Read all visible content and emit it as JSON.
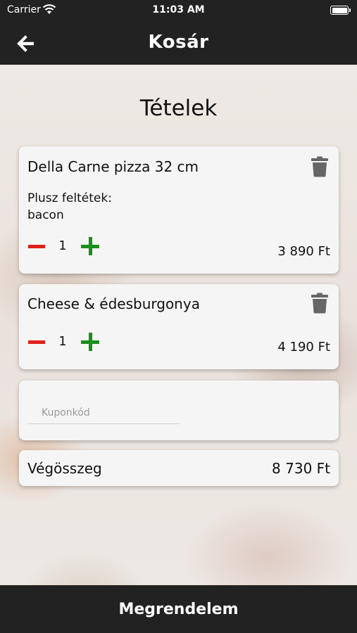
{
  "status_bar": {
    "carrier": "Carrier",
    "time": "11:03 AM"
  },
  "nav": {
    "title": "Kosár",
    "back_icon": "arrow-left-icon"
  },
  "section_title": "Tételek",
  "cart": {
    "items": [
      {
        "name": "Della Carne pizza 32 cm",
        "extras_label": "Plusz feltétek:",
        "extras": "bacon",
        "quantity": "1",
        "price": "3 890 Ft"
      },
      {
        "name": "Cheese & édesburgonya",
        "quantity": "1",
        "price": "4 190 Ft"
      }
    ],
    "coupon_placeholder": "Kuponkód",
    "total_label": "Végösszeg",
    "total_value": "8 730 Ft"
  },
  "order_button_label": "Megrendelem",
  "colors": {
    "bar_background": "#222222",
    "card_background": "#f5f5f5",
    "minus": "#e0201c",
    "plus": "#1a8f1a",
    "trash": "#666666"
  }
}
